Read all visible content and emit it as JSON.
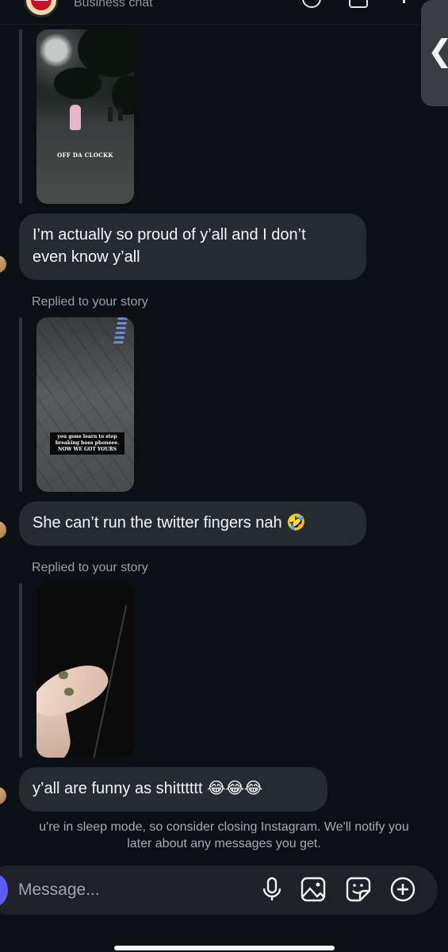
{
  "header": {
    "subtitle": "Business chat"
  },
  "stories": [
    {
      "caption": "OFF DA CLOCKK"
    },
    {
      "caption_lines": [
        "you gone learn to stop",
        "breaking hoes phoneee.",
        "NOW WE GOT YOURS"
      ]
    },
    {
      "caption": ""
    }
  ],
  "messages": [
    {
      "text_line1": "I’m actually so proud of y’all and I don’t",
      "text_line2": "even know y’all"
    },
    {
      "replied_label": "Replied to your story",
      "text": "She can’t run the twitter fingers nah",
      "emoji": "🤣"
    },
    {
      "replied_label": "Replied to your story",
      "text": "y’all are funny as shitttttt",
      "emoji": "😂😂😂"
    }
  ],
  "sleep_notice": {
    "line1": "u're in sleep mode, so consider closing Instagram. We'll notify you",
    "line2": "later about any messages you get."
  },
  "composer": {
    "placeholder": "Message...",
    "icons": [
      "microphone-icon",
      "gallery-icon",
      "sticker-icon",
      "add-icon"
    ]
  },
  "colors": {
    "background": "#0c0f14",
    "bubble": "#262a31",
    "camera_button": "#5a5cf5",
    "secondary_text": "#9aa0a8"
  }
}
